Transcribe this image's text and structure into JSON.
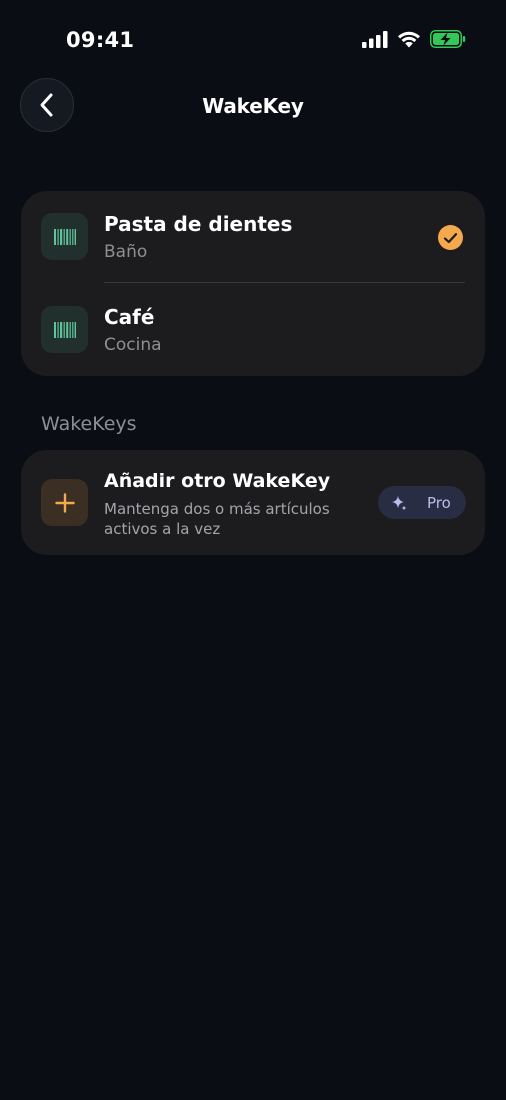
{
  "status_bar": {
    "time": "09:41",
    "icons": [
      "cellular-signal-icon",
      "wifi-icon",
      "battery-charging-icon"
    ]
  },
  "header": {
    "title": "WakeKey",
    "back_icon": "chevron-left-icon"
  },
  "items": [
    {
      "name": "Pasta de dientes",
      "location": "Baño",
      "icon": "barcode-icon",
      "selected": true
    },
    {
      "name": "Café",
      "location": "Cocina",
      "icon": "barcode-icon",
      "selected": false
    }
  ],
  "section": {
    "label": "WakeKeys"
  },
  "add_wakekey": {
    "title": "Añadir otro WakeKey",
    "description": "Mantenga dos o más artículos activos a la vez",
    "icon": "plus-icon",
    "badge_label": "Pro",
    "badge_icon": "sparkle-icon"
  },
  "colors": {
    "background": "#0a0d14",
    "card": "#1c1c1e",
    "accent_orange": "#f5a94f",
    "barcode_green": "#5fc49c",
    "battery_green": "#34c759",
    "pro_badge": "#282d44"
  }
}
